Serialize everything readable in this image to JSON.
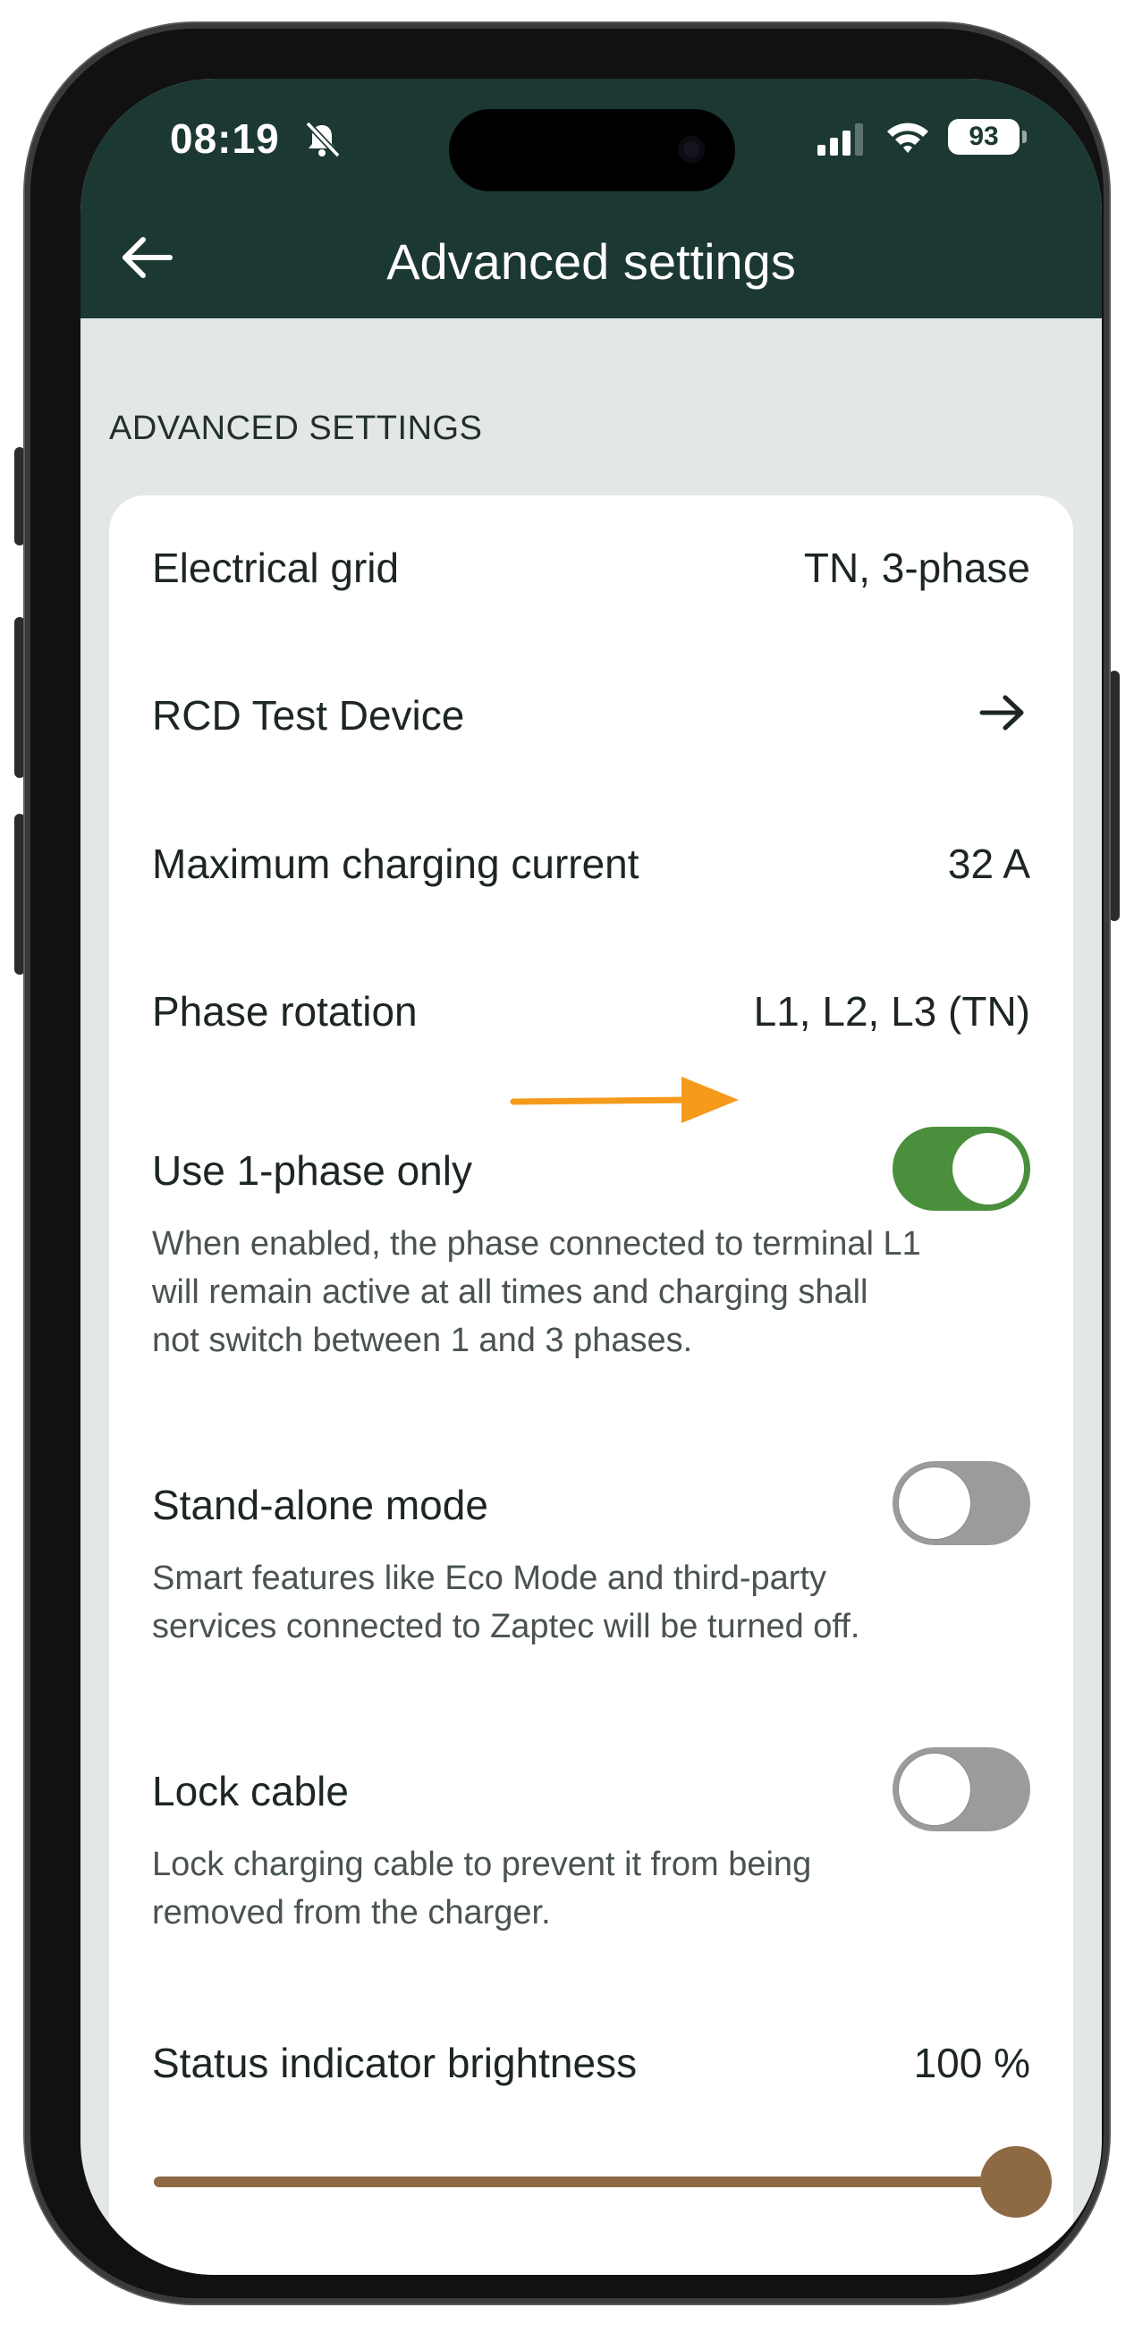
{
  "status_bar": {
    "time": "08:19",
    "battery": "93",
    "icons": [
      "bell-slash-icon",
      "signal-icon",
      "wifi-icon",
      "battery-icon"
    ]
  },
  "header": {
    "title": "Advanced settings",
    "back_icon": "arrow-left-icon"
  },
  "section": {
    "title": "ADVANCED SETTINGS"
  },
  "settings": {
    "electrical_grid": {
      "label": "Electrical grid",
      "value": "TN, 3-phase"
    },
    "rcd_test": {
      "label": "RCD Test Device",
      "icon": "arrow-right-icon"
    },
    "max_current": {
      "label": "Maximum charging current",
      "value": "32 A"
    },
    "phase_rotation": {
      "label": "Phase rotation",
      "value": "L1, L2, L3 (TN)"
    },
    "one_phase": {
      "label": "Use 1-phase only",
      "enabled": true,
      "desc_line1": "When enabled, the phase connected to terminal L1",
      "desc_line2": "will remain active at all times and charging shall",
      "desc_line3": "not switch between 1 and 3 phases."
    },
    "standalone": {
      "label": "Stand-alone mode",
      "enabled": false,
      "desc_line1": "Smart features like Eco Mode and third-party",
      "desc_line2": "services connected to Zaptec will be turned off."
    },
    "lock_cable": {
      "label": "Lock cable",
      "enabled": false,
      "desc_line1": "Lock charging cable to prevent it from being",
      "desc_line2": "removed from the charger."
    },
    "brightness": {
      "label": "Status indicator brightness",
      "value": "100 %",
      "level_fraction": 1.0
    }
  },
  "colors": {
    "header_bg": "#1c3833",
    "toggle_on": "#4a8f3b",
    "toggle_off": "#9b9b9b",
    "slider": "#8d6a44",
    "annotation_arrow": "#f59a1b",
    "page_bg": "#e4e7e8"
  }
}
